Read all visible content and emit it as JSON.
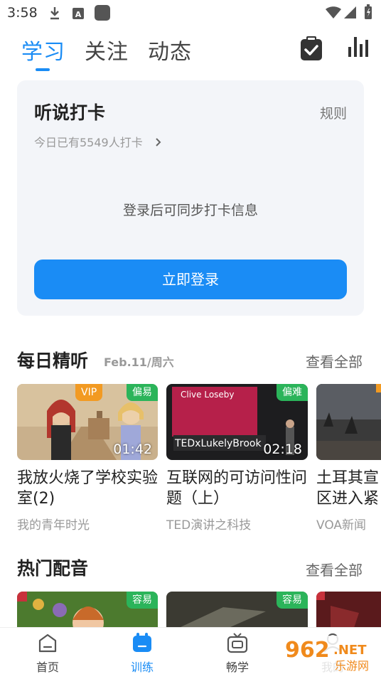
{
  "status": {
    "time": "3:58"
  },
  "tabs": [
    {
      "label": "学习"
    },
    {
      "label": "关注"
    },
    {
      "label": "动态"
    }
  ],
  "checkin": {
    "title": "听说打卡",
    "rule_label": "规则",
    "today_count": "今日已有5549人打卡",
    "sync_message": "登录后可同步打卡信息",
    "login_button": "立即登录"
  },
  "daily_listening": {
    "title": "每日精听",
    "date": "Feb.11/周六",
    "see_all": "查看全部",
    "items": [
      {
        "title": "我放火烧了学校实验室(2)",
        "source": "我的青年时光",
        "duration": "01:42",
        "difficulty": "偏易",
        "vip": "VIP"
      },
      {
        "title": "互联网的可访问性问题（上）",
        "source": "TED演讲之科技",
        "duration": "02:18",
        "difficulty": "偏难",
        "thumb_speaker": "Clive Loseby",
        "thumb_event": "TEDxLukelyBrook"
      },
      {
        "title": "土耳其宣区进入紧",
        "source": "VOA新闻"
      }
    ]
  },
  "hot_dubbing": {
    "title": "热门配音",
    "see_all": "查看全部",
    "items": [
      {
        "difficulty": "容易"
      },
      {
        "difficulty": "容易"
      }
    ]
  },
  "bottom_nav": [
    {
      "label": "首页",
      "icon": "home-icon"
    },
    {
      "label": "训练",
      "icon": "training-icon"
    },
    {
      "label": "畅学",
      "icon": "tv-icon"
    },
    {
      "label": "我的",
      "icon": "profile-icon"
    }
  ],
  "watermark": {
    "number": "962",
    "tld": ".NET",
    "text": "乐游网"
  },
  "colors": {
    "accent": "#1a8cf5",
    "easy_green": "#2bb45a",
    "vip_orange": "#f29a22"
  }
}
